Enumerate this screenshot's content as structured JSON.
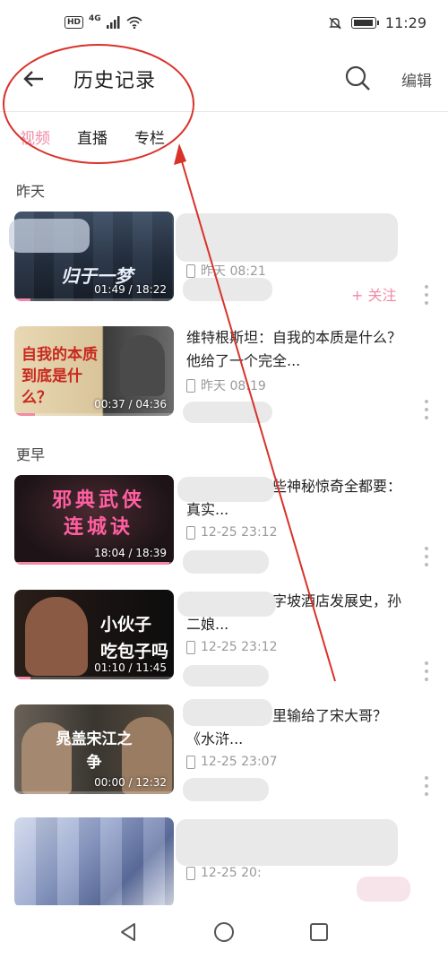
{
  "status_bar": {
    "network_badge": "HD",
    "network_type": "4G",
    "time": "11:29",
    "icons": [
      "hd-icon",
      "signal-icon",
      "wifi-icon",
      "mute-icon",
      "battery-icon"
    ]
  },
  "header": {
    "title": "历史记录",
    "edit_label": "编辑"
  },
  "tabs": [
    {
      "label": "视频",
      "active": true
    },
    {
      "label": "直播",
      "active": false
    },
    {
      "label": "专栏",
      "active": false
    }
  ],
  "sections": {
    "yesterday": "昨天",
    "earlier": "更早"
  },
  "items": [
    {
      "title": "",
      "thumb_text": "归于一梦",
      "duration": "01:49 / 18:22",
      "progress": 0.1,
      "time": "昨天 08:21",
      "follow": "+ 关注"
    },
    {
      "title": "维特根斯坦：自我的本质是什么？他给了一个完全...",
      "thumb_text": "自我的本质到底是什么？",
      "duration": "00:37 / 04:36",
      "progress": 0.13,
      "time": "昨天 08:19",
      "follow": ""
    },
    {
      "title": "《连城诀》那些神秘惊奇全都要：真实...",
      "thumb_text": "邪典武侠 连城诀",
      "duration": "18:04 / 18:39",
      "progress": 0.97,
      "time": "12-25 23:12",
      "follow": ""
    },
    {
      "title": "《水浒传》十字坡酒店发展史，孙二娘...",
      "thumb_text": "小伙子 吃包子吗",
      "duration": "01:10 / 11:45",
      "progress": 0.1,
      "time": "12-25 23:12",
      "follow": ""
    },
    {
      "title": "晁天王到底哪里输给了宋大哥？《水浒...",
      "thumb_text": "晁盖宋江之争",
      "duration": "00:00 / 12:32",
      "progress": 0.0,
      "time": "12-25 23:07",
      "follow": ""
    },
    {
      "title": "",
      "thumb_text": "",
      "duration": "",
      "progress": 0.0,
      "time": "12-25 20:",
      "follow": ""
    }
  ],
  "colors": {
    "accent": "#f08aa6",
    "annotation": "#d9322a"
  }
}
